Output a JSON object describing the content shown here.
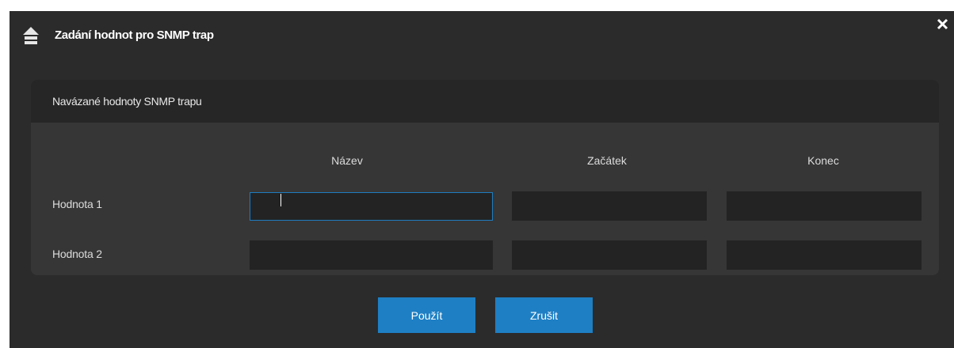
{
  "dialog": {
    "title": "Zadání hodnot pro SNMP trap",
    "title_icon": "home-icon",
    "close_icon": "close-icon"
  },
  "panel": {
    "title": "Navázané hodnoty SNMP trapu",
    "columns": [
      "Název",
      "Začátek",
      "Konec"
    ],
    "rows": [
      {
        "label": "Hodnota 1",
        "name": "",
        "start": "",
        "end": ""
      },
      {
        "label": "Hodnota 2",
        "name": "",
        "start": "",
        "end": ""
      }
    ]
  },
  "buttons": {
    "apply_label": "Použít",
    "cancel_label": "Zrušit"
  },
  "colors": {
    "accent": "#1e7fc4",
    "background": "#2b2b2b",
    "panel": "#363636",
    "panel_header": "#262626",
    "field": "#232323"
  }
}
